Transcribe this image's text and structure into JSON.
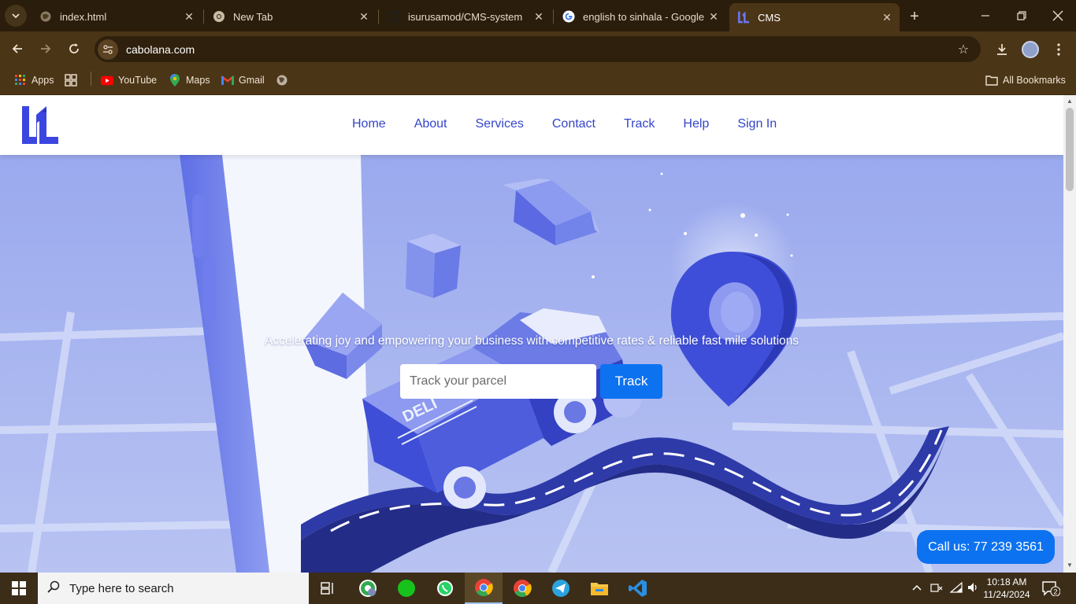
{
  "browser": {
    "tabs": [
      {
        "title": "index.html",
        "icon": "globe-icon",
        "active": false
      },
      {
        "title": "New Tab",
        "icon": "chrome-icon",
        "active": false
      },
      {
        "title": "isurusamod/CMS-system",
        "icon": "github-icon",
        "active": false
      },
      {
        "title": "english to sinhala - Google S",
        "icon": "google-icon",
        "active": false
      },
      {
        "title": "CMS",
        "icon": "cms-logo-icon",
        "active": true
      }
    ],
    "url": "cabolana.com",
    "bookmarks": [
      {
        "label": "Apps",
        "icon": "apps-grid-icon"
      },
      {
        "label": "",
        "icon": "tab-groups-icon"
      },
      {
        "label": "YouTube",
        "icon": "youtube-icon"
      },
      {
        "label": "Maps",
        "icon": "maps-icon"
      },
      {
        "label": "Gmail",
        "icon": "gmail-icon"
      },
      {
        "label": "",
        "icon": "globe-icon"
      }
    ],
    "all_bookmarks": "All Bookmarks"
  },
  "site": {
    "nav": [
      "Home",
      "About",
      "Services",
      "Contact",
      "Track",
      "Help",
      "Sign In"
    ],
    "hero": {
      "tagline": "Accelerating joy and empowering your business with competitive rates & reliable fast mile solutions",
      "track_placeholder": "Track your parcel",
      "track_button": "Track",
      "van_text": "DELI"
    },
    "call_button": "Call us: 77 239 3561",
    "colors": {
      "brand": "#3b46e0",
      "accent": "#0d72f0",
      "hero_bg": "#9fb0ee"
    }
  },
  "taskbar": {
    "search_placeholder": "Type here to search",
    "apps": [
      "task-view-icon",
      "chrome-profile-icon",
      "green-circle-app-icon",
      "whatsapp-icon",
      "chrome-icon",
      "chrome-icon",
      "telegram-icon",
      "file-explorer-icon",
      "vscode-icon"
    ],
    "time": "10:18 AM",
    "date": "11/24/2024",
    "notifications": "2"
  }
}
